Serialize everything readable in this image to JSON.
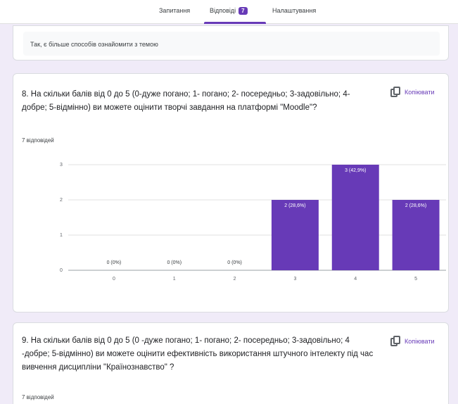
{
  "tabs": [
    {
      "label": "Запитання"
    },
    {
      "label": "Відповіді",
      "badge": "7"
    },
    {
      "label": "Налаштування"
    }
  ],
  "previous_answer": {
    "text": "Так, є більше способів ознайомити з темою"
  },
  "question8": {
    "title": "8.  На скільки балів від 0 до 5 (0-дуже погано; 1- погано; 2- посередньо; 3-задовільно; 4-добре; 5-відмінно) ви можете оцінити творчі завдання на платформі \"Moodle\"?",
    "responses": "7 відповідей",
    "copy_label": "Копіювати"
  },
  "question9": {
    "title": "9.  На скільки балів від 0 до 5 (0 -дуже погано; 1- погано; 2- посередньо; 3-задовільно; 4 -добре; 5-відмінно) ви можете оцінити ефективність використання штучного інтелекту під час вивчення дисципліни \"Країнознавство\" ?",
    "responses": "7 відповідей",
    "copy_label": "Копіювати"
  },
  "colors": {
    "accent": "#673ab7"
  },
  "chart_data": {
    "type": "bar",
    "categories": [
      "0",
      "1",
      "2",
      "3",
      "4",
      "5"
    ],
    "values": [
      0,
      0,
      0,
      2,
      3,
      2
    ],
    "data_labels": [
      "0 (0%)",
      "0 (0%)",
      "0 (0%)",
      "2 (28,6%)",
      "3 (42,9%)",
      "2 (28,6%)"
    ],
    "y_ticks": [
      "0",
      "1",
      "2",
      "3"
    ],
    "ylim": [
      0,
      3
    ],
    "grid": true,
    "color": "#673ab7"
  }
}
